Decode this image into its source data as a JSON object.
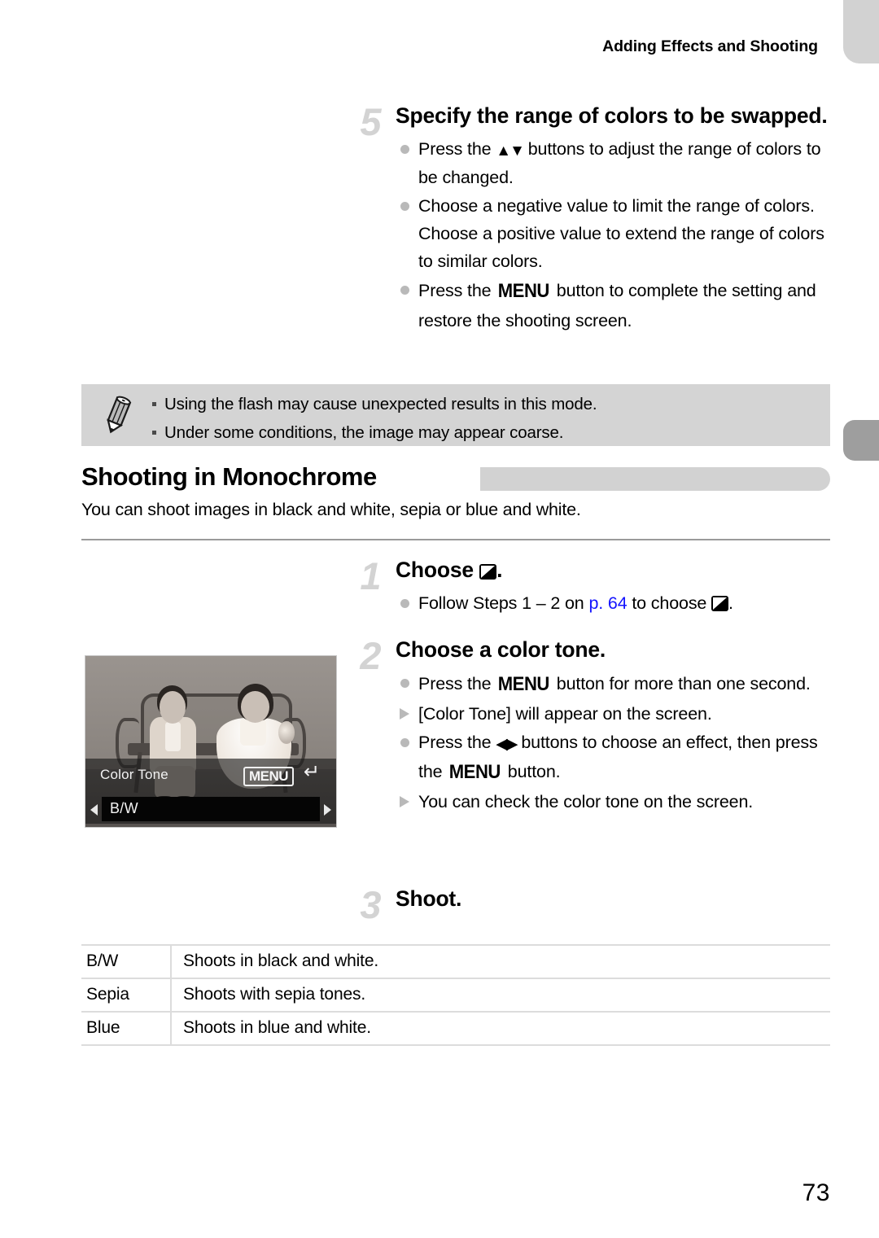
{
  "header": {
    "running_title": "Adding Effects and Shooting"
  },
  "step5": {
    "number": "5",
    "title": "Specify the range of colors to be swapped.",
    "bullets": [
      {
        "marker": "dot",
        "pre": "Press the ",
        "glyph": "updown",
        "post": " buttons to adjust the range of colors to be changed."
      },
      {
        "marker": "dot",
        "pre": "Choose a negative value to limit the range of colors. Choose a positive value to extend the range of colors to similar colors.",
        "glyph": "",
        "post": ""
      },
      {
        "marker": "dot",
        "pre": "Press the ",
        "glyph": "menu",
        "post": " button to complete the setting and restore the shooting screen."
      }
    ]
  },
  "note": {
    "icon": "pencil-icon",
    "items": [
      "Using the flash may cause unexpected results in this mode.",
      "Under some conditions, the image may appear coarse."
    ]
  },
  "section": {
    "title": "Shooting in Monochrome",
    "subtitle": "You can shoot images in black and white, sepia or blue and white."
  },
  "step1": {
    "number": "1",
    "title_pre": "Choose ",
    "title_post": ".",
    "bullets": [
      {
        "marker": "dot",
        "pre": "Follow Steps 1 – 2 on ",
        "link": "p. 64",
        "mid": " to choose ",
        "post": "."
      }
    ]
  },
  "step2": {
    "number": "2",
    "title": "Choose a color tone.",
    "bullets": [
      {
        "marker": "dot",
        "pre": "Press the ",
        "glyph": "menu",
        "post": " button for more than one second."
      },
      {
        "marker": "tri",
        "pre": "[Color Tone] will appear on the screen.",
        "glyph": "",
        "post": ""
      },
      {
        "marker": "dot",
        "pre": "Press the ",
        "glyph": "leftright",
        "post": " buttons to choose an effect, then press the ",
        "glyph2": "menu",
        "post2": " button."
      },
      {
        "marker": "tri",
        "pre": "You can check the color tone on the screen.",
        "glyph": "",
        "post": ""
      }
    ]
  },
  "step3": {
    "number": "3",
    "title": "Shoot."
  },
  "camera_screen": {
    "label": "Color Tone",
    "menu_button": "MENU",
    "return_icon": "return-arrow-icon",
    "selected_value": "B/W",
    "left_arrow": "prev-arrow-icon",
    "right_arrow": "next-arrow-icon"
  },
  "table": {
    "rows": [
      {
        "key": "B/W",
        "value": "Shoots in black and white."
      },
      {
        "key": "Sepia",
        "value": "Shoots with sepia tones."
      },
      {
        "key": "Blue",
        "value": "Shoots in blue and white."
      }
    ]
  },
  "footer": {
    "page_number": "73"
  },
  "colors": {
    "tab_light": "#d2d2d2",
    "tab_active": "#9e9e9e",
    "note_bg": "#d4d4d4",
    "link": "#1414ff",
    "step_number": "#d3d3d3"
  }
}
